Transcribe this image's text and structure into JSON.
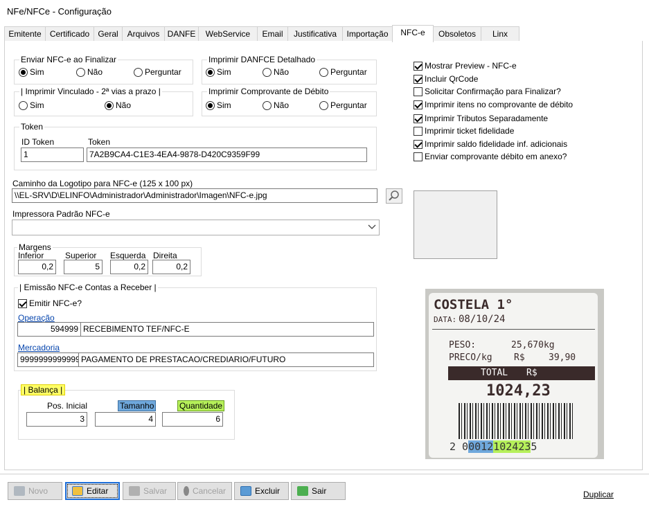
{
  "window": {
    "title": "NFe/NFCe - Configuração"
  },
  "tabs": [
    "Emitente",
    "Certificado",
    "Geral",
    "Arquivos",
    "DANFE",
    "WebService",
    "Email",
    "Justificativa",
    "Importação",
    "NFC-e",
    "Obsoletos",
    "Linx"
  ],
  "enviar": {
    "title": "Enviar NFC-e ao Finalizar",
    "options": [
      "Sim",
      "Não",
      "Perguntar"
    ],
    "selected": "Sim"
  },
  "detalhado": {
    "title": "Imprimir DANFCE Detalhado",
    "options": [
      "Sim",
      "Não",
      "Perguntar"
    ],
    "selected": "Sim"
  },
  "vinculado": {
    "title": "| Imprimir Vinculado - 2ª vias a prazo |",
    "options": [
      "Sim",
      "Não"
    ],
    "selected": "Não"
  },
  "debito": {
    "title": "Imprimir Comprovante de Débito",
    "options": [
      "Sim",
      "Não",
      "Perguntar"
    ],
    "selected": "Sim"
  },
  "token": {
    "title": "Token",
    "id_label": "ID Token",
    "id_value": "1",
    "token_label": "Token",
    "token_value": "7A2B9CA4-C1E3-4EA4-9878-D420C9359F99"
  },
  "logo": {
    "label": "Caminho da Logotipo para NFC-e (125 x 100 px)",
    "value": "\\\\EL-SRV\\D\\ELINFO\\Administrador\\Administrador\\Imagen\\NFC-e.jpg"
  },
  "impressora": {
    "label": "Impressora Padrão NFC-e",
    "value": ""
  },
  "margens": {
    "title": "Margens",
    "inferior_label": "Inferior",
    "inferior": "0,2",
    "superior_label": "Superior",
    "superior": "5",
    "esquerda_label": "Esquerda",
    "esquerda": "0,2",
    "direita_label": "Direita",
    "direita": "0,2"
  },
  "contas": {
    "title": "| Emissão NFC-e Contas a Receber |",
    "emitir_label": "Emitir NFC-e?",
    "emitir_checked": true,
    "operacao_label": "Operação",
    "operacao_code": "594999",
    "operacao_desc": "RECEBIMENTO TEF/NFC-E",
    "mercadoria_label": "Mercadoria",
    "mercadoria_code": "9999999999999",
    "mercadoria_desc": "PAGAMENTO DE PRESTACAO/CREDIARIO/FUTURO"
  },
  "balanca": {
    "title": "| Balança |",
    "pos_label": "Pos. Inicial",
    "pos_value": "3",
    "tam_label": "Tamanho",
    "tam_value": "4",
    "qtd_label": "Quantidade",
    "qtd_value": "6"
  },
  "options": [
    {
      "label": "Mostrar Preview - NFC-e",
      "checked": true
    },
    {
      "label": "Incluir QrCode",
      "checked": true
    },
    {
      "label": "Solicitar Confirmação para Finalizar?",
      "checked": false
    },
    {
      "label": "Imprimir itens no comprovante de débito",
      "checked": true
    },
    {
      "label": "Imprimir Tributos Separadamente",
      "checked": true
    },
    {
      "label": "Imprimir ticket fidelidade",
      "checked": false
    },
    {
      "label": "Imprimir saldo fidelidade inf. adicionais",
      "checked": true
    },
    {
      "label": "Enviar comprovante débito em anexo?",
      "checked": false
    }
  ],
  "label_image": {
    "product": "COSTELA 1°",
    "date_label": "DATA:",
    "date": "08/10/24",
    "peso_label": "PESO:",
    "peso": "25,670kg",
    "preco_label": "PRECO/kg",
    "currency": "R$",
    "preco": "39,90",
    "total_label": "TOTAL",
    "total_currency": "R$",
    "total": "1024,23",
    "barcode_prefix": "2 0",
    "barcode_tam": "0012",
    "barcode_mid": "1",
    "barcode_qtd": "02423",
    "barcode_end": "5"
  },
  "buttons": {
    "novo": "Novo",
    "editar": "Editar",
    "salvar": "Salvar",
    "cancelar": "Cancelar",
    "excluir": "Excluir",
    "sair": "Sair",
    "duplicar": "Duplicar"
  },
  "colors": {
    "highlight_yellow": "#ffff66",
    "highlight_blue": "#6fa8dc",
    "highlight_green": "#b6f05a",
    "label_dark": "#3a2a2a"
  }
}
